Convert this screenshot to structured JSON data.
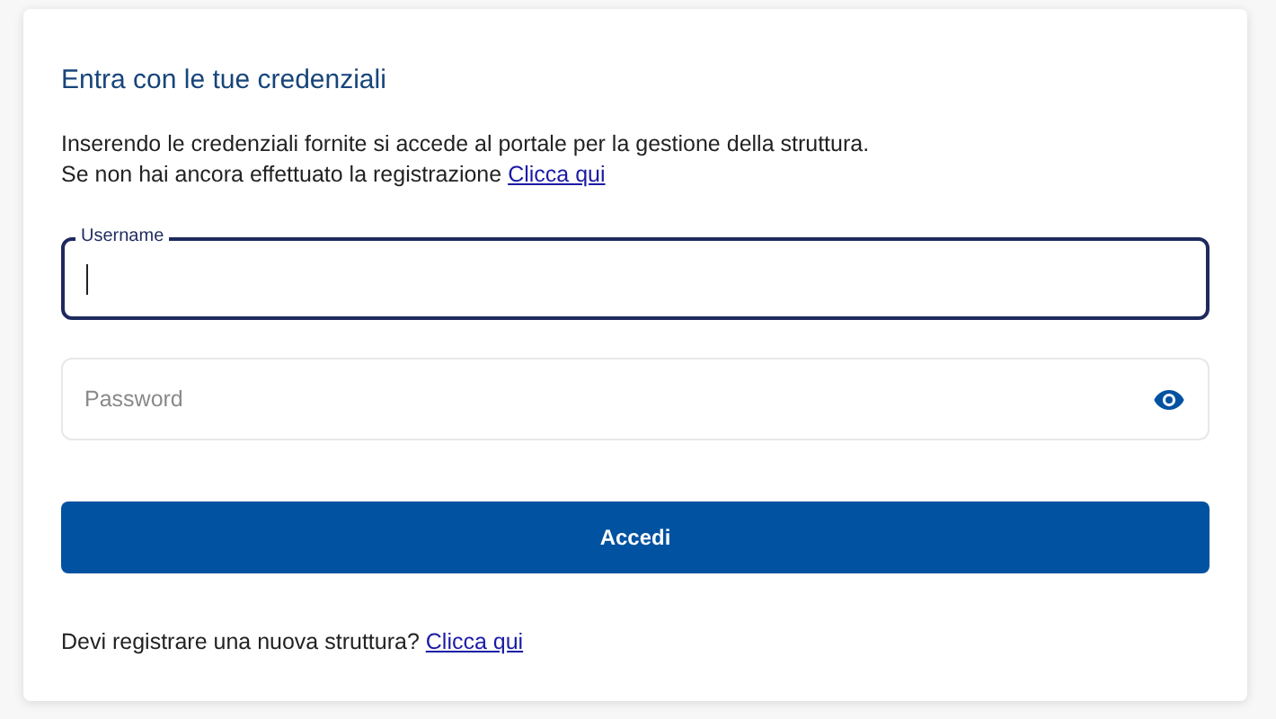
{
  "title": "Entra con le tue credenziali",
  "intro": [
    {
      "text": "Inserendo le credenziali fornite si accede al portale per la gestione della struttura."
    },
    {
      "text": "Se non hai ancora effettuato la registrazione",
      "link": "Clicca qui"
    }
  ],
  "fields": [
    {
      "kind": "text",
      "label": "Username",
      "focused": true
    },
    {
      "kind": "password",
      "label": "Password",
      "focused": false
    }
  ],
  "submit": "Accedi",
  "footer": {
    "text": "Devi registrare una nuova struttura?",
    "link": "Clicca qui"
  }
}
